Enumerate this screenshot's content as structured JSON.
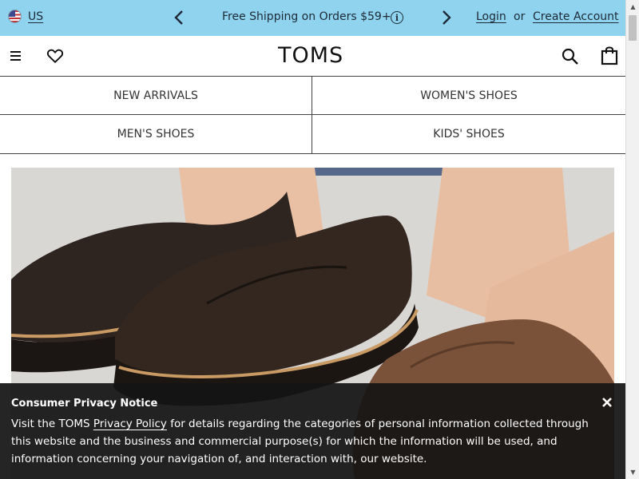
{
  "promo_bar": {
    "region_label": "US",
    "message": "Free Shipping on Orders $59+",
    "login_label": "Login",
    "or_label": "or",
    "create_account_label": "Create Account",
    "background_color": "#8fd3ef"
  },
  "header": {
    "logo_text": "TOMS",
    "icons": [
      "menu-icon",
      "heart-icon",
      "search-icon",
      "bag-icon"
    ]
  },
  "nav": {
    "items": [
      {
        "label": "NEW ARRIVALS"
      },
      {
        "label": "WOMEN'S SHOES"
      },
      {
        "label": "MEN'S SHOES"
      },
      {
        "label": "KIDS' SHOES"
      }
    ]
  },
  "privacy_notice": {
    "title": "Consumer Privacy Notice",
    "body_before": "Visit the TOMS ",
    "policy_link": "Privacy Policy",
    "body_after": " for details regarding the categories of personal information collected through this website and the business and commercial purpose(s) for which the information will be used, and information concerning your navigation of, and interaction with, our website.",
    "close_icon": "close-icon"
  }
}
